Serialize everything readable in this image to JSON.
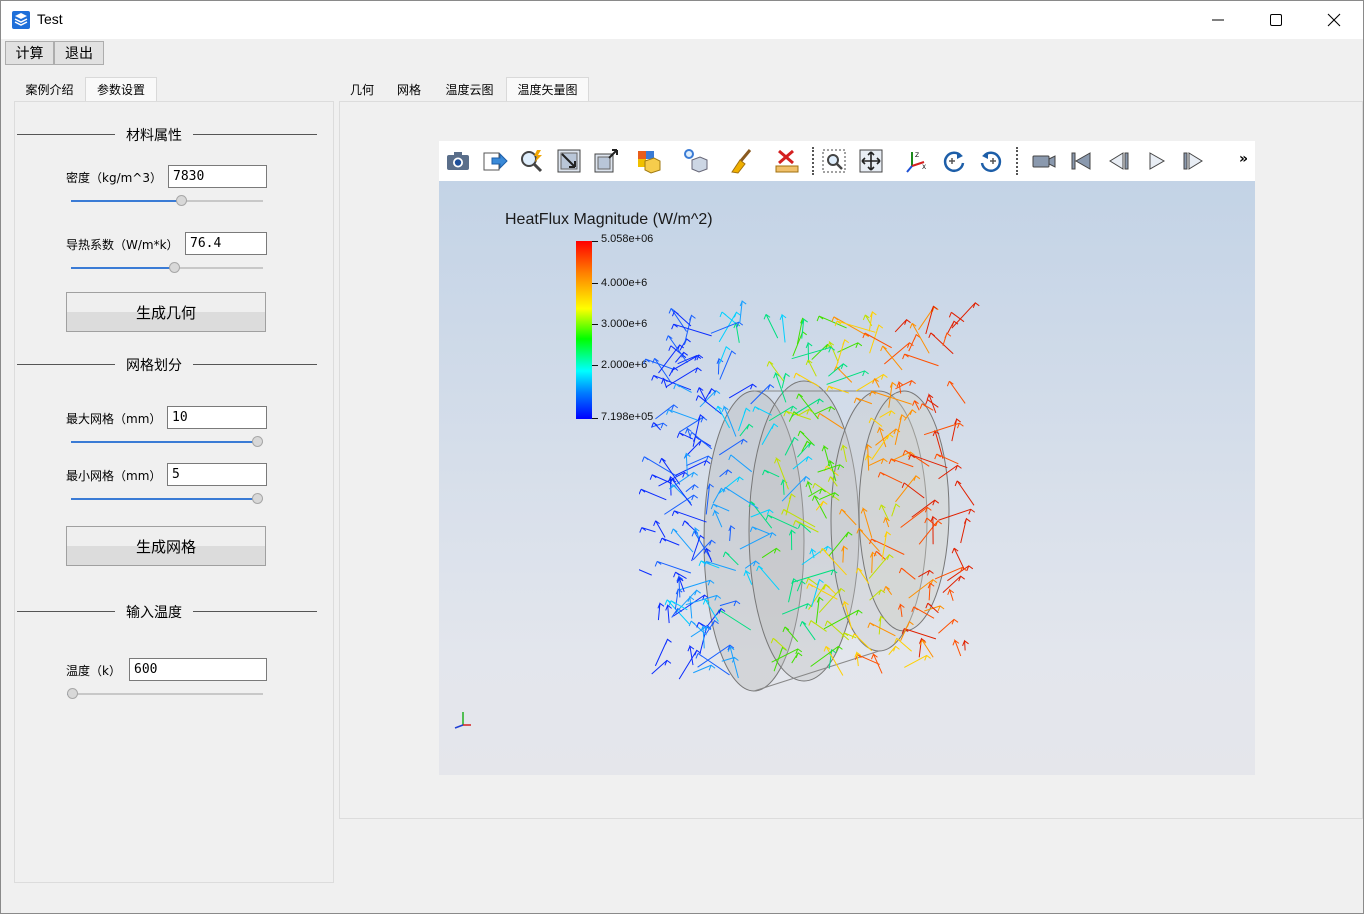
{
  "window": {
    "title": "Test"
  },
  "menu": {
    "calc": "计算",
    "exit": "退出"
  },
  "left_tabs": [
    "案例介绍",
    "参数设置"
  ],
  "sections": {
    "material": "材料属性",
    "mesh": "网格划分",
    "temperature": "输入温度"
  },
  "fields": {
    "density": {
      "label": "密度（kg/m^3）",
      "value": "7830",
      "slider_fraction": 0.58
    },
    "conductivity": {
      "label": "导热系数（W/m*k）",
      "value": "76.4",
      "slider_fraction": 0.54
    },
    "max_mesh": {
      "label": "最大网格（mm）",
      "value": "10",
      "slider_fraction": 1.0
    },
    "min_mesh": {
      "label": "最小网格（mm）",
      "value": "5",
      "slider_fraction": 1.0
    },
    "temp": {
      "label": "温度（k）",
      "value": "600",
      "slider_fraction": 0.0
    }
  },
  "buttons": {
    "gen_geometry": "生成几何",
    "gen_mesh": "生成网格"
  },
  "right_tabs": [
    "几何",
    "网格",
    "温度云图",
    "温度矢量图"
  ],
  "legend": {
    "title": "HeatFlux Magnitude (W/m^2)",
    "labels": [
      "5.058e+06",
      "4.000e+6",
      "3.000e+6",
      "2.000e+6",
      "7.198e+05"
    ]
  },
  "toolbar_icons": [
    "camera-icon",
    "export-icon",
    "zoom-interactive-icon",
    "reset-camera-icon",
    "fullscreen-icon",
    "select-cells-icon",
    "select-points-icon",
    "clear-selection-icon",
    "measure-icon",
    "zoom-box-icon",
    "pan-icon",
    "axes-orient-icon",
    "rotate-cw-icon",
    "rotate-ccw-icon",
    "record-icon",
    "first-frame-icon",
    "prev-frame-icon",
    "play-icon",
    "last-frame-icon"
  ],
  "toolbar_more": "»"
}
